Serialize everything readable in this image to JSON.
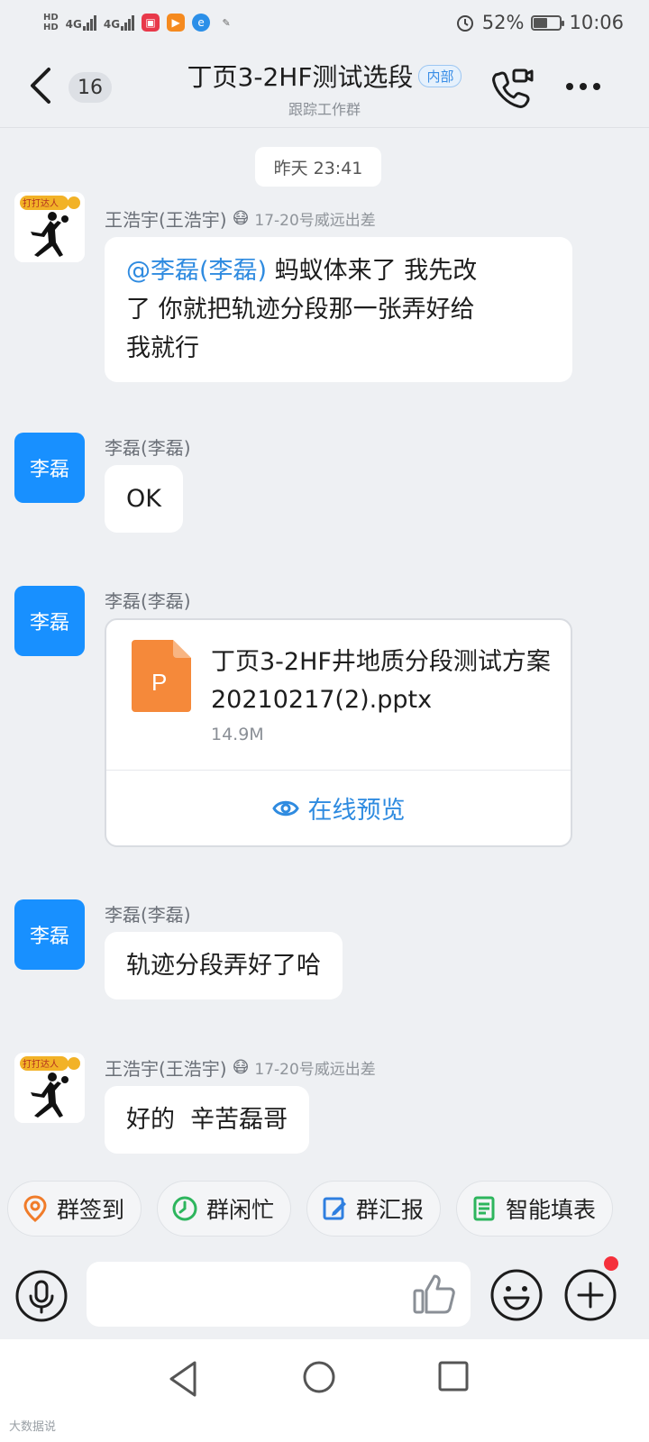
{
  "status_bar": {
    "hd1": "HD",
    "hd2": "HD",
    "net1": "4G",
    "net2": "4G",
    "battery_pct": "52%",
    "battery_level": 0.52,
    "time": "10:06"
  },
  "header": {
    "unread_count": "16",
    "title": "丁页3-2HF测试选段",
    "tag": "内部",
    "subtitle": "跟踪工作群"
  },
  "messages": {
    "timestamp": "昨天 23:41",
    "m1": {
      "sender": "王浩宇(王浩宇)",
      "status_emoji": "😷",
      "status_text": "17-20号威远出差",
      "mention": "@李磊(李磊)",
      "text_line1": " 蚂蚁体来了 我先改",
      "text_line2": "了 你就把轨迹分段那一张弄好给",
      "text_line3": "我就行"
    },
    "m2": {
      "avatar_text": "李磊",
      "sender": "李磊(李磊)",
      "text": "OK"
    },
    "m3": {
      "avatar_text": "李磊",
      "sender": "李磊(李磊)",
      "file_icon_letter": "P",
      "file_name": "丁页3-2HF井地质分段测试方案20210217(2).pptx",
      "file_size": "14.9M",
      "preview_label": "在线预览"
    },
    "m4": {
      "avatar_text": "李磊",
      "sender": "李磊(李磊)",
      "text": "轨迹分段弄好了哈"
    },
    "m5": {
      "sender": "王浩宇(王浩宇)",
      "status_emoji": "😷",
      "status_text": "17-20号威远出差",
      "text": "好的  辛苦磊哥"
    }
  },
  "quick_actions": [
    {
      "label": "群签到",
      "icon": "location-pin-icon",
      "color": "#f07c2a"
    },
    {
      "label": "群闲忙",
      "icon": "clock-icon",
      "color": "#2db55d"
    },
    {
      "label": "群汇报",
      "icon": "edit-report-icon",
      "color": "#2f7fe0"
    },
    {
      "label": "智能填表",
      "icon": "form-icon",
      "color": "#2db55d"
    }
  ],
  "input": {
    "placeholder": ""
  },
  "watermark": "大数据说"
}
